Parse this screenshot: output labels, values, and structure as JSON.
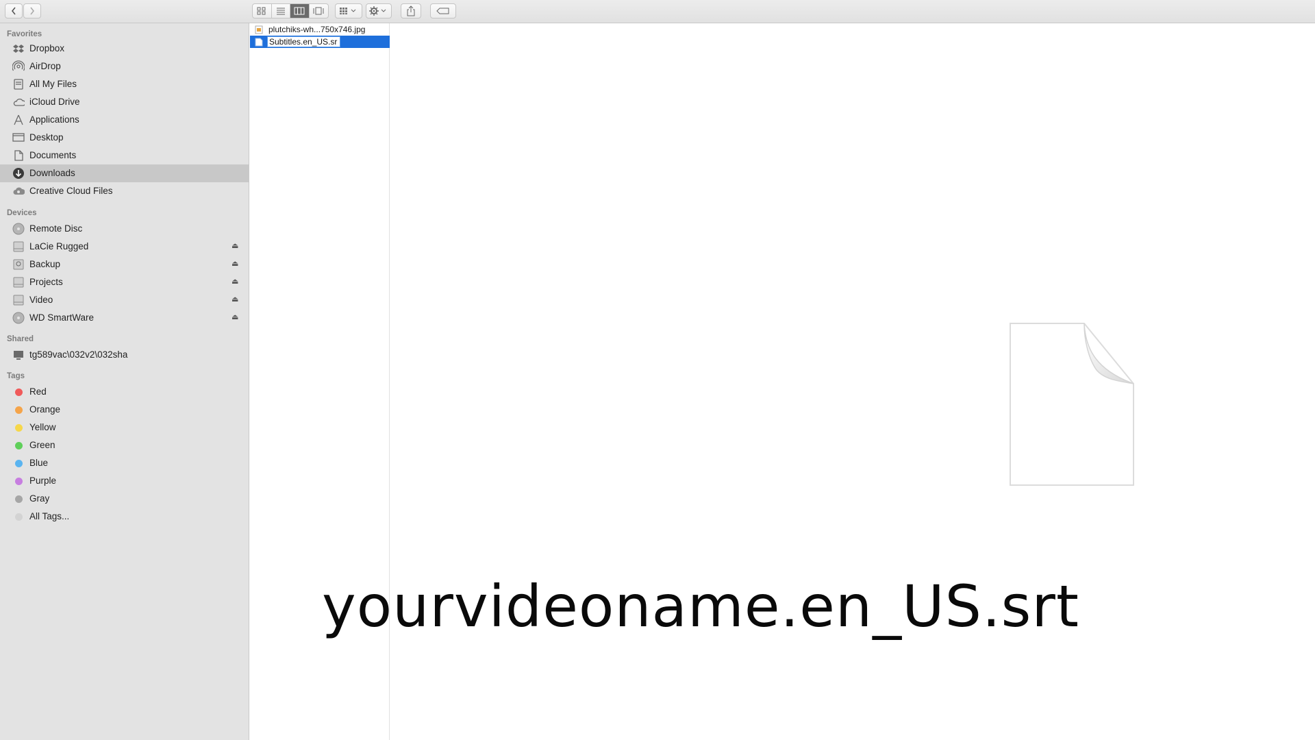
{
  "toolbar": {
    "back_icon": "chevron-left-icon",
    "forward_icon": "chevron-right-icon",
    "view_modes": [
      "icon-view",
      "list-view",
      "column-view",
      "cover-flow-view"
    ],
    "active_view": "column-view",
    "arrange_icon": "arrange-grid-icon",
    "action_icon": "gear-icon",
    "share_icon": "share-icon",
    "tag_icon": "tag-icon"
  },
  "sidebar": {
    "favorites_title": "Favorites",
    "favorites": [
      {
        "label": "Dropbox",
        "icon": "dropbox-icon"
      },
      {
        "label": "AirDrop",
        "icon": "airdrop-icon"
      },
      {
        "label": "All My Files",
        "icon": "all-files-icon"
      },
      {
        "label": "iCloud Drive",
        "icon": "cloud-icon"
      },
      {
        "label": "Applications",
        "icon": "applications-icon"
      },
      {
        "label": "Desktop",
        "icon": "desktop-icon"
      },
      {
        "label": "Documents",
        "icon": "documents-icon"
      },
      {
        "label": "Downloads",
        "icon": "downloads-icon",
        "selected": true
      },
      {
        "label": "Creative Cloud Files",
        "icon": "creative-cloud-icon"
      }
    ],
    "devices_title": "Devices",
    "devices": [
      {
        "label": "Remote Disc",
        "icon": "disc-icon",
        "eject": false
      },
      {
        "label": "LaCie Rugged",
        "icon": "drive-icon",
        "eject": true
      },
      {
        "label": "Backup",
        "icon": "backup-drive-icon",
        "eject": true
      },
      {
        "label": "Projects",
        "icon": "drive-icon",
        "eject": true
      },
      {
        "label": "Video",
        "icon": "drive-icon",
        "eject": true
      },
      {
        "label": "WD SmartWare",
        "icon": "disc-icon",
        "eject": true
      }
    ],
    "eject_glyph": "⏏",
    "shared_title": "Shared",
    "shared": [
      {
        "label": "tg589vac\\032v2\\032sha",
        "icon": "network-computer-icon"
      }
    ],
    "tags_title": "Tags",
    "tags": [
      {
        "label": "Red",
        "color": "#f05a5a"
      },
      {
        "label": "Orange",
        "color": "#f5a44a"
      },
      {
        "label": "Yellow",
        "color": "#f6d74a"
      },
      {
        "label": "Green",
        "color": "#5fcf5a"
      },
      {
        "label": "Blue",
        "color": "#5ab4f0"
      },
      {
        "label": "Purple",
        "color": "#c77ee0"
      },
      {
        "label": "Gray",
        "color": "#a6a6a6"
      },
      {
        "label": "All Tags...",
        "color": "#d3d3d3"
      }
    ]
  },
  "files": [
    {
      "name": "plutchiks-wh...750x746.jpg",
      "icon": "image-file-icon",
      "selected": false
    },
    {
      "name": "Subtitles.en_US.srt",
      "icon": "document-file-icon",
      "selected": true,
      "renaming": true,
      "rename_value": "Subtitles.en_US.sr"
    }
  ],
  "preview": {
    "icon": "blank-document-icon"
  },
  "caption": "yourvideoname.en_US.srt"
}
